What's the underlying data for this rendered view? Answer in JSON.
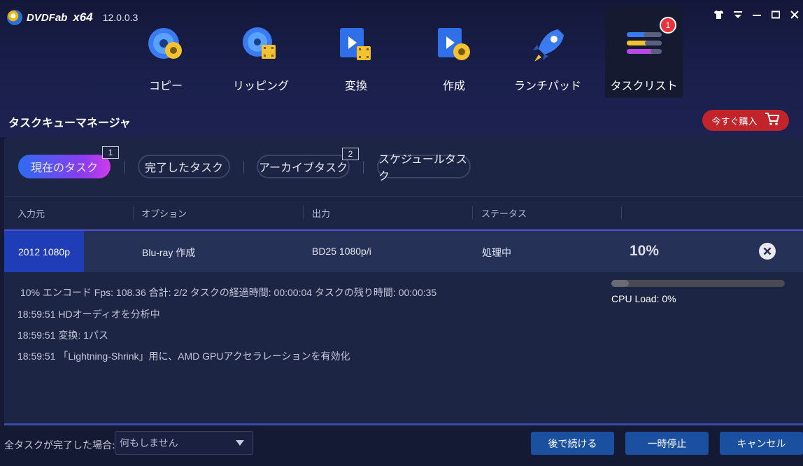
{
  "app": {
    "brand": "DVDFab",
    "arch": "x64",
    "version": "12.0.0.3"
  },
  "window_controls": [
    "skin-icon",
    "menu-icon",
    "minimize-icon",
    "maximize-icon",
    "close-icon"
  ],
  "nav": [
    {
      "label": "コピー",
      "icon": "disc-copy-icon"
    },
    {
      "label": "リッピング",
      "icon": "disc-ripper-icon"
    },
    {
      "label": "変換",
      "icon": "video-converter-icon"
    },
    {
      "label": "作成",
      "icon": "disc-creator-icon"
    },
    {
      "label": "ランチパッド",
      "icon": "rocket-icon"
    },
    {
      "label": "タスクリスト",
      "icon": "task-list-icon",
      "badge": "1",
      "active": true
    }
  ],
  "page_title": "タスクキューマネージャ",
  "buy_button": {
    "label": "今すぐ購入",
    "icon": "cart-icon"
  },
  "tabs": [
    {
      "label": "現在のタスク",
      "badge": "1",
      "active": true
    },
    {
      "label": "完了したタスク"
    },
    {
      "label": "アーカイブタスク",
      "badge": "2"
    },
    {
      "label": "スケジュールタスク"
    }
  ],
  "columns": [
    "入力元",
    "オプション",
    "出力",
    "ステータス"
  ],
  "task": {
    "source": "2012 1080p",
    "option": "Blu-ray 作成",
    "output": "BD25 1080p/i",
    "status": "処理中",
    "percent": "10%"
  },
  "log": [
    "10%  エンコード  Fps: 108.36   合計: 2/2  タスクの経過時間: 00:00:04  タスクの残り時間: 00:00:35",
    "18:59:51  HDオーディオを分析中",
    "18:59:51  変換: 1パス",
    "18:59:51 「Lightning-Shrink」用に、AMD GPUアクセラレーションを有効化"
  ],
  "progress_fraction": 0.1,
  "cpu_load": "CPU Load: 0%",
  "footer": {
    "on_complete_label": "全タスクが完了した場合:",
    "on_complete_value": "何もしません",
    "buttons": [
      "後で続ける",
      "一時停止",
      "キャンセル"
    ]
  },
  "colors": {
    "accent": "#2d6cf0",
    "buy": "#c1242b",
    "badge": "#e8323c",
    "footer_button": "#1b4fa0"
  }
}
